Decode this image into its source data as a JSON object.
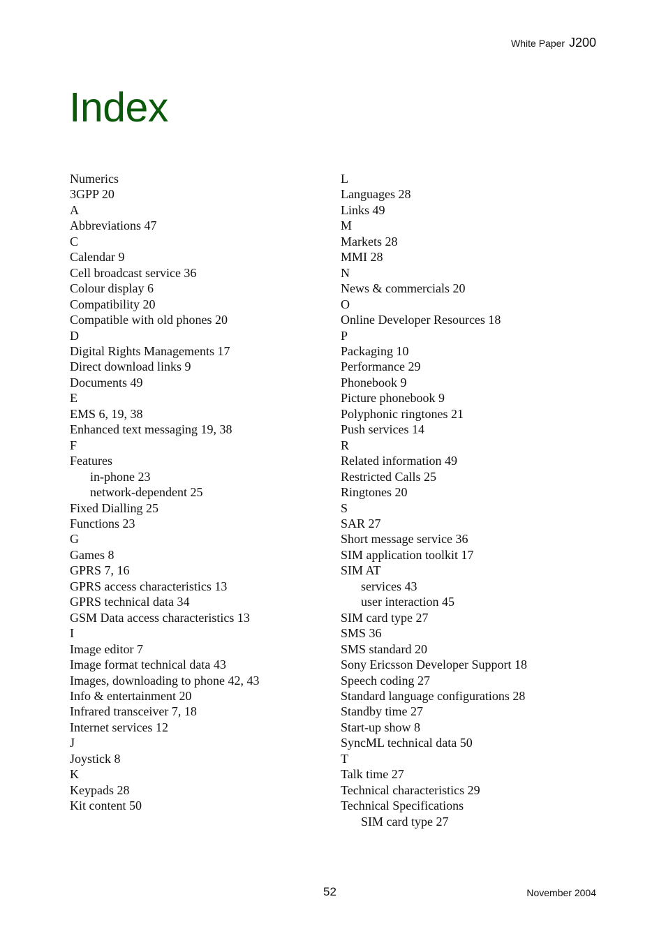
{
  "header": {
    "doc_type": "White Paper",
    "model": "J200"
  },
  "title": "Index",
  "index": {
    "left": [
      {
        "text": "Numerics",
        "kind": "letter"
      },
      {
        "text": "3GPP 20",
        "kind": "entry"
      },
      {
        "text": "A",
        "kind": "letter"
      },
      {
        "text": "Abbreviations 47",
        "kind": "entry"
      },
      {
        "text": "C",
        "kind": "letter"
      },
      {
        "text": "Calendar 9",
        "kind": "entry"
      },
      {
        "text": "Cell broadcast service 36",
        "kind": "entry"
      },
      {
        "text": "Colour display 6",
        "kind": "entry"
      },
      {
        "text": "Compatibility 20",
        "kind": "entry"
      },
      {
        "text": "Compatible with old phones 20",
        "kind": "entry"
      },
      {
        "text": "D",
        "kind": "letter"
      },
      {
        "text": "Digital Rights Managements 17",
        "kind": "entry"
      },
      {
        "text": "Direct download links 9",
        "kind": "entry"
      },
      {
        "text": "Documents 49",
        "kind": "entry"
      },
      {
        "text": "E",
        "kind": "letter"
      },
      {
        "text": "EMS 6, 19, 38",
        "kind": "entry"
      },
      {
        "text": "Enhanced text messaging 19, 38",
        "kind": "entry"
      },
      {
        "text": "F",
        "kind": "letter"
      },
      {
        "text": "Features",
        "kind": "entry"
      },
      {
        "text": "in-phone 23",
        "kind": "sub"
      },
      {
        "text": "network-dependent 25",
        "kind": "sub"
      },
      {
        "text": "Fixed Dialling 25",
        "kind": "entry"
      },
      {
        "text": "Functions 23",
        "kind": "entry"
      },
      {
        "text": "G",
        "kind": "letter"
      },
      {
        "text": "Games 8",
        "kind": "entry"
      },
      {
        "text": "GPRS 7, 16",
        "kind": "entry"
      },
      {
        "text": "GPRS access characteristics 13",
        "kind": "entry"
      },
      {
        "text": "GPRS technical data 34",
        "kind": "entry"
      },
      {
        "text": "GSM Data access characteristics 13",
        "kind": "entry"
      },
      {
        "text": "I",
        "kind": "letter"
      },
      {
        "text": "Image editor 7",
        "kind": "entry"
      },
      {
        "text": "Image format technical data 43",
        "kind": "entry"
      },
      {
        "text": "Images, downloading to phone 42, 43",
        "kind": "entry"
      },
      {
        "text": "Info & entertainment 20",
        "kind": "entry"
      },
      {
        "text": "Infrared transceiver 7, 18",
        "kind": "entry"
      },
      {
        "text": "Internet services 12",
        "kind": "entry"
      },
      {
        "text": "J",
        "kind": "letter"
      },
      {
        "text": "Joystick 8",
        "kind": "entry"
      },
      {
        "text": "K",
        "kind": "letter"
      },
      {
        "text": "Keypads 28",
        "kind": "entry"
      },
      {
        "text": "Kit content 50",
        "kind": "entry"
      }
    ],
    "right": [
      {
        "text": "L",
        "kind": "letter"
      },
      {
        "text": "Languages 28",
        "kind": "entry"
      },
      {
        "text": "Links 49",
        "kind": "entry"
      },
      {
        "text": "M",
        "kind": "letter"
      },
      {
        "text": "Markets 28",
        "kind": "entry"
      },
      {
        "text": "MMI 28",
        "kind": "entry"
      },
      {
        "text": "N",
        "kind": "letter"
      },
      {
        "text": "News & commercials 20",
        "kind": "entry"
      },
      {
        "text": "O",
        "kind": "letter"
      },
      {
        "text": "Online Developer Resources 18",
        "kind": "entry"
      },
      {
        "text": "P",
        "kind": "letter"
      },
      {
        "text": "Packaging 10",
        "kind": "entry"
      },
      {
        "text": "Performance 29",
        "kind": "entry"
      },
      {
        "text": "Phonebook 9",
        "kind": "entry"
      },
      {
        "text": "Picture phonebook 9",
        "kind": "entry"
      },
      {
        "text": "Polyphonic ringtones 21",
        "kind": "entry"
      },
      {
        "text": "Push services 14",
        "kind": "entry"
      },
      {
        "text": "R",
        "kind": "letter"
      },
      {
        "text": "Related information 49",
        "kind": "entry"
      },
      {
        "text": "Restricted Calls 25",
        "kind": "entry"
      },
      {
        "text": "Ringtones 20",
        "kind": "entry"
      },
      {
        "text": "S",
        "kind": "letter"
      },
      {
        "text": "SAR 27",
        "kind": "entry"
      },
      {
        "text": "Short message service 36",
        "kind": "entry"
      },
      {
        "text": "SIM application toolkit 17",
        "kind": "entry"
      },
      {
        "text": "SIM AT",
        "kind": "entry"
      },
      {
        "text": "services 43",
        "kind": "sub"
      },
      {
        "text": "user interaction 45",
        "kind": "sub"
      },
      {
        "text": "SIM card type 27",
        "kind": "entry"
      },
      {
        "text": "SMS 36",
        "kind": "entry"
      },
      {
        "text": "SMS standard 20",
        "kind": "entry"
      },
      {
        "text": "Sony Ericsson Developer Support 18",
        "kind": "entry"
      },
      {
        "text": "Speech coding 27",
        "kind": "entry"
      },
      {
        "text": "Standard language configurations 28",
        "kind": "entry"
      },
      {
        "text": "Standby time 27",
        "kind": "entry"
      },
      {
        "text": "Start-up show 8",
        "kind": "entry"
      },
      {
        "text": "SyncML technical data 50",
        "kind": "entry"
      },
      {
        "text": "T",
        "kind": "letter"
      },
      {
        "text": "Talk time 27",
        "kind": "entry"
      },
      {
        "text": "Technical characteristics 29",
        "kind": "entry"
      },
      {
        "text": "Technical Specifications",
        "kind": "entry"
      },
      {
        "text": "SIM card type 27",
        "kind": "sub"
      }
    ]
  },
  "footer": {
    "page_number": "52",
    "date": "November 2004"
  },
  "colors": {
    "title": "#0b5a0b",
    "text": "#111111"
  }
}
